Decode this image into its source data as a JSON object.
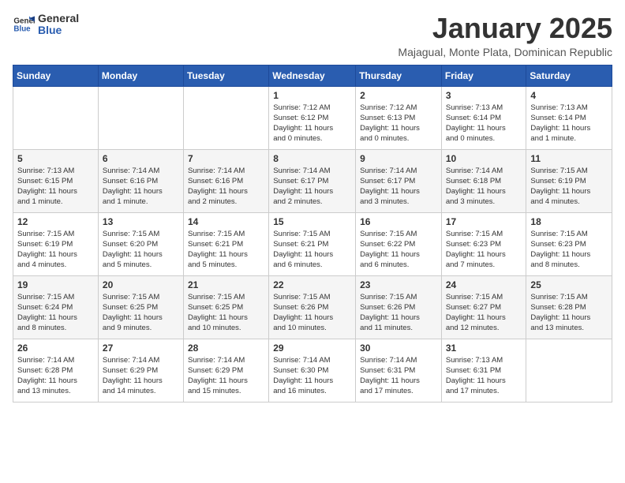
{
  "logo": {
    "text_general": "General",
    "text_blue": "Blue"
  },
  "title": "January 2025",
  "subtitle": "Majagual, Monte Plata, Dominican Republic",
  "days_of_week": [
    "Sunday",
    "Monday",
    "Tuesday",
    "Wednesday",
    "Thursday",
    "Friday",
    "Saturday"
  ],
  "weeks": [
    [
      {
        "day": "",
        "info": ""
      },
      {
        "day": "",
        "info": ""
      },
      {
        "day": "",
        "info": ""
      },
      {
        "day": "1",
        "info": "Sunrise: 7:12 AM\nSunset: 6:12 PM\nDaylight: 11 hours\nand 0 minutes."
      },
      {
        "day": "2",
        "info": "Sunrise: 7:12 AM\nSunset: 6:13 PM\nDaylight: 11 hours\nand 0 minutes."
      },
      {
        "day": "3",
        "info": "Sunrise: 7:13 AM\nSunset: 6:14 PM\nDaylight: 11 hours\nand 0 minutes."
      },
      {
        "day": "4",
        "info": "Sunrise: 7:13 AM\nSunset: 6:14 PM\nDaylight: 11 hours\nand 1 minute."
      }
    ],
    [
      {
        "day": "5",
        "info": "Sunrise: 7:13 AM\nSunset: 6:15 PM\nDaylight: 11 hours\nand 1 minute."
      },
      {
        "day": "6",
        "info": "Sunrise: 7:14 AM\nSunset: 6:16 PM\nDaylight: 11 hours\nand 1 minute."
      },
      {
        "day": "7",
        "info": "Sunrise: 7:14 AM\nSunset: 6:16 PM\nDaylight: 11 hours\nand 2 minutes."
      },
      {
        "day": "8",
        "info": "Sunrise: 7:14 AM\nSunset: 6:17 PM\nDaylight: 11 hours\nand 2 minutes."
      },
      {
        "day": "9",
        "info": "Sunrise: 7:14 AM\nSunset: 6:17 PM\nDaylight: 11 hours\nand 3 minutes."
      },
      {
        "day": "10",
        "info": "Sunrise: 7:14 AM\nSunset: 6:18 PM\nDaylight: 11 hours\nand 3 minutes."
      },
      {
        "day": "11",
        "info": "Sunrise: 7:15 AM\nSunset: 6:19 PM\nDaylight: 11 hours\nand 4 minutes."
      }
    ],
    [
      {
        "day": "12",
        "info": "Sunrise: 7:15 AM\nSunset: 6:19 PM\nDaylight: 11 hours\nand 4 minutes."
      },
      {
        "day": "13",
        "info": "Sunrise: 7:15 AM\nSunset: 6:20 PM\nDaylight: 11 hours\nand 5 minutes."
      },
      {
        "day": "14",
        "info": "Sunrise: 7:15 AM\nSunset: 6:21 PM\nDaylight: 11 hours\nand 5 minutes."
      },
      {
        "day": "15",
        "info": "Sunrise: 7:15 AM\nSunset: 6:21 PM\nDaylight: 11 hours\nand 6 minutes."
      },
      {
        "day": "16",
        "info": "Sunrise: 7:15 AM\nSunset: 6:22 PM\nDaylight: 11 hours\nand 6 minutes."
      },
      {
        "day": "17",
        "info": "Sunrise: 7:15 AM\nSunset: 6:23 PM\nDaylight: 11 hours\nand 7 minutes."
      },
      {
        "day": "18",
        "info": "Sunrise: 7:15 AM\nSunset: 6:23 PM\nDaylight: 11 hours\nand 8 minutes."
      }
    ],
    [
      {
        "day": "19",
        "info": "Sunrise: 7:15 AM\nSunset: 6:24 PM\nDaylight: 11 hours\nand 8 minutes."
      },
      {
        "day": "20",
        "info": "Sunrise: 7:15 AM\nSunset: 6:25 PM\nDaylight: 11 hours\nand 9 minutes."
      },
      {
        "day": "21",
        "info": "Sunrise: 7:15 AM\nSunset: 6:25 PM\nDaylight: 11 hours\nand 10 minutes."
      },
      {
        "day": "22",
        "info": "Sunrise: 7:15 AM\nSunset: 6:26 PM\nDaylight: 11 hours\nand 10 minutes."
      },
      {
        "day": "23",
        "info": "Sunrise: 7:15 AM\nSunset: 6:26 PM\nDaylight: 11 hours\nand 11 minutes."
      },
      {
        "day": "24",
        "info": "Sunrise: 7:15 AM\nSunset: 6:27 PM\nDaylight: 11 hours\nand 12 minutes."
      },
      {
        "day": "25",
        "info": "Sunrise: 7:15 AM\nSunset: 6:28 PM\nDaylight: 11 hours\nand 13 minutes."
      }
    ],
    [
      {
        "day": "26",
        "info": "Sunrise: 7:14 AM\nSunset: 6:28 PM\nDaylight: 11 hours\nand 13 minutes."
      },
      {
        "day": "27",
        "info": "Sunrise: 7:14 AM\nSunset: 6:29 PM\nDaylight: 11 hours\nand 14 minutes."
      },
      {
        "day": "28",
        "info": "Sunrise: 7:14 AM\nSunset: 6:29 PM\nDaylight: 11 hours\nand 15 minutes."
      },
      {
        "day": "29",
        "info": "Sunrise: 7:14 AM\nSunset: 6:30 PM\nDaylight: 11 hours\nand 16 minutes."
      },
      {
        "day": "30",
        "info": "Sunrise: 7:14 AM\nSunset: 6:31 PM\nDaylight: 11 hours\nand 17 minutes."
      },
      {
        "day": "31",
        "info": "Sunrise: 7:13 AM\nSunset: 6:31 PM\nDaylight: 11 hours\nand 17 minutes."
      },
      {
        "day": "",
        "info": ""
      }
    ]
  ]
}
